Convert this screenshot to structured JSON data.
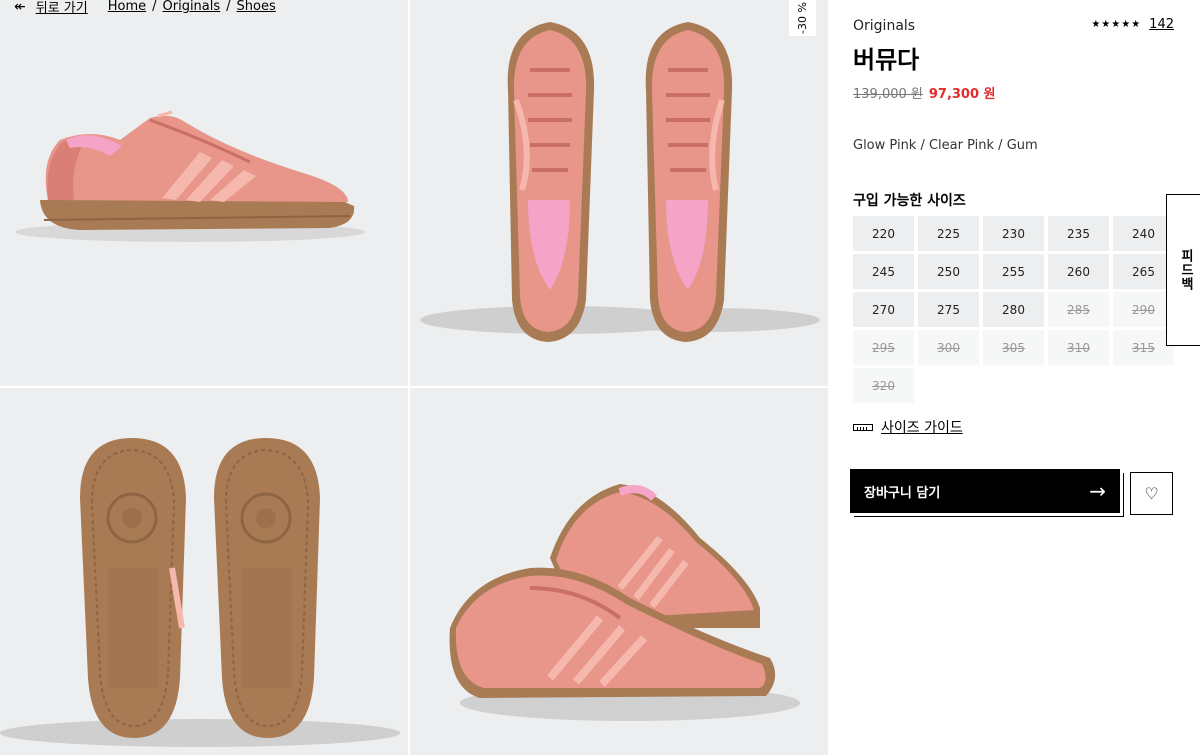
{
  "breadcrumb": {
    "back_label": "뒤로 가기",
    "items": [
      "Home",
      "Originals",
      "Shoes"
    ]
  },
  "gallery": {
    "discount_badge": "-30 %",
    "images": [
      {
        "view": "side view, pink suede sneaker with gum sole"
      },
      {
        "view": "top view pair"
      },
      {
        "view": "outsole pair"
      },
      {
        "view": "angled pair"
      }
    ]
  },
  "product": {
    "brand": "Originals",
    "rating_stars": "★★★★★",
    "review_count": "142",
    "name": "버뮤다",
    "original_price": "139,000 원",
    "sale_price": "97,300 원",
    "colorway": "Glow Pink / Clear Pink / Gum"
  },
  "sizes": {
    "title": "구입 가능한 사이즈",
    "available": [
      "220",
      "225",
      "230",
      "235",
      "240",
      "245",
      "250",
      "255",
      "260",
      "265",
      "270",
      "275",
      "280"
    ],
    "unavailable": [
      "285",
      "290",
      "295",
      "300",
      "305",
      "310",
      "315",
      "320"
    ]
  },
  "size_guide_label": "사이즈 가이드",
  "cart_button_label": "장바구니 담기",
  "cart_arrow": "→",
  "wishlist_icon": "♡",
  "feedback_label": "피드백",
  "colors": {
    "suede": "#e8958a",
    "suede_dark": "#d97f76",
    "stripe": "#f6b8ad",
    "gum": "#a97b55",
    "gum_dark": "#8e6542",
    "sale_red": "#e32b2b",
    "tile_bg": "#eceeef"
  }
}
